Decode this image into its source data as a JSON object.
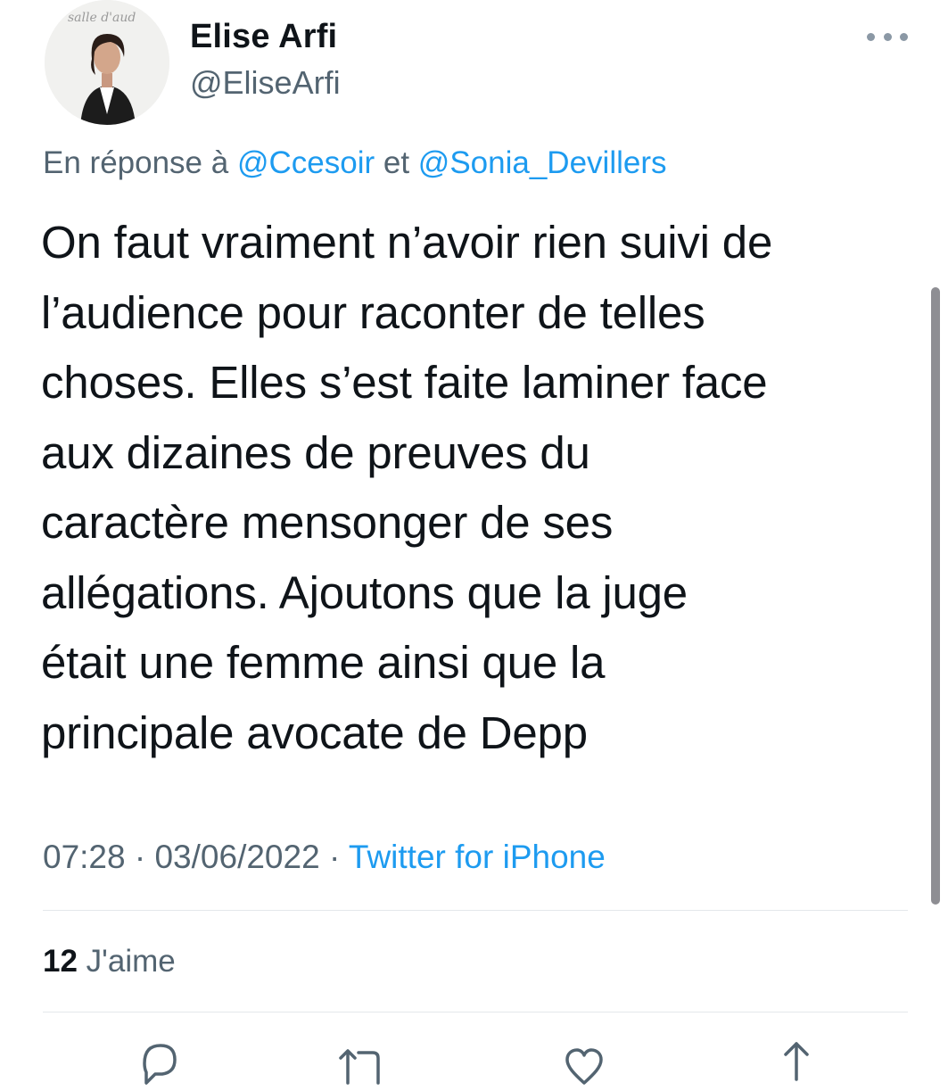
{
  "author": {
    "display_name": "Elise Arfi",
    "handle": "@EliseArfi",
    "avatar_text": "salle d'aud"
  },
  "reply": {
    "prefix": "En réponse à",
    "user1": "@Ccesoir",
    "joiner": "et",
    "user2": "@Sonia_Devillers"
  },
  "tweet": {
    "text": "On faut vraiment n’avoir rien suivi de\nl’audience pour raconter de telles\nchoses. Elles s’est faite laminer face\naux dizaines de preuves du\ncaractère mensonger de ses\nallégations. Ajoutons que la juge\nétait une femme ainsi que la\nprincipale avocate de Depp"
  },
  "meta": {
    "time": "07:28",
    "separator": "·",
    "date": "03/06/2022",
    "source": "Twitter for iPhone"
  },
  "stats": {
    "likes_count": "12",
    "likes_label": "J'aime"
  },
  "actions": {
    "reply_icon": "reply-icon",
    "retweet_icon": "retweet-icon",
    "like_icon": "heart-icon",
    "share_icon": "share-icon"
  },
  "colors": {
    "link": "#1d9bf0",
    "secondary_text": "#536471",
    "primary_text": "#0f1419",
    "divider": "#e4e8eb"
  }
}
